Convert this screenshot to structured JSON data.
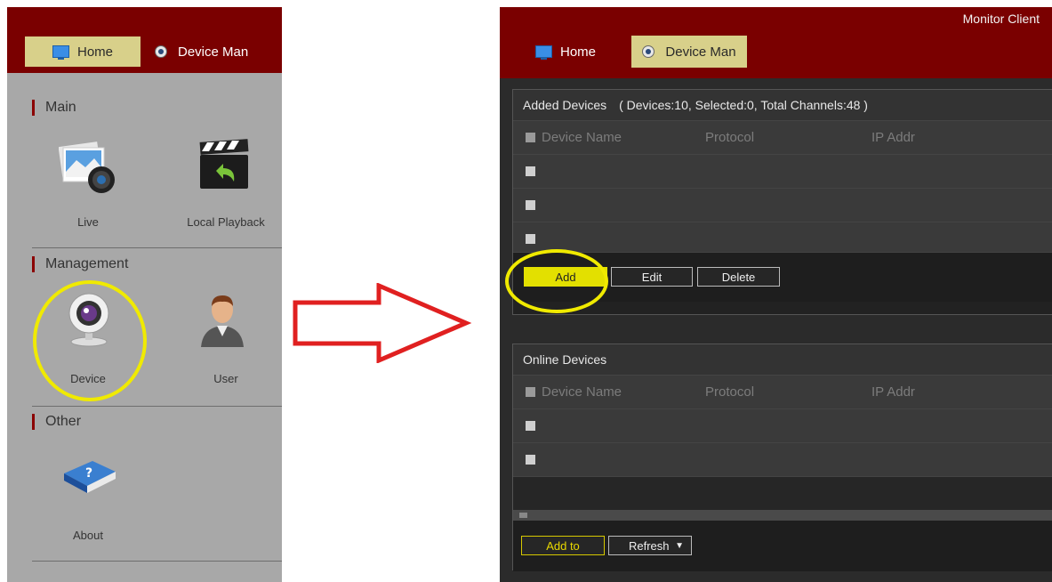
{
  "left": {
    "tabs": {
      "home": "Home",
      "device_man": "Device Man"
    },
    "sections": {
      "main": "Main",
      "management": "Management",
      "other": "Other"
    },
    "items": {
      "live": "Live",
      "local_playback": "Local Playback",
      "device": "Device",
      "user": "User",
      "about": "About"
    }
  },
  "right": {
    "app_title": "Monitor Client",
    "tabs": {
      "home": "Home",
      "device_man": "Device Man"
    },
    "added_devices": {
      "title": "Added Devices",
      "info": "( Devices:10, Selected:0, Total Channels:48 )",
      "columns": [
        "Device Name",
        "Protocol",
        "IP Addr"
      ],
      "buttons": {
        "add": "Add",
        "edit": "Edit",
        "delete": "Delete"
      }
    },
    "online_devices": {
      "title": "Online Devices",
      "columns": [
        "Device Name",
        "Protocol",
        "IP Addr"
      ],
      "buttons": {
        "add_to": "Add to",
        "refresh": "Refresh"
      }
    }
  },
  "colors": {
    "header_bg": "#7a0000",
    "active_tab": "#d8d08a",
    "highlight": "#f0ea00",
    "arrow": "#e02020"
  }
}
